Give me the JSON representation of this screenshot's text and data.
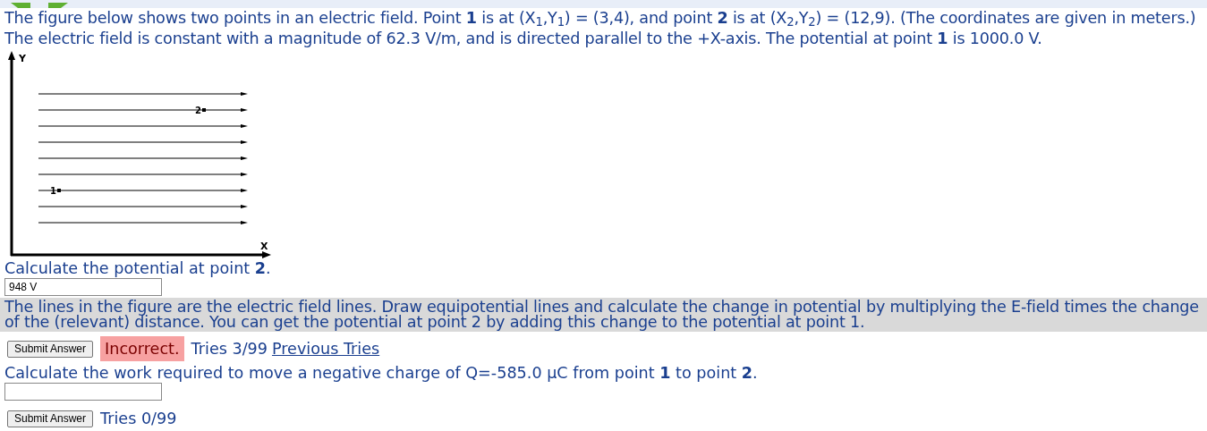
{
  "problem": {
    "text": "The figure below shows two points in an electric field. Point **1** is at (X$_{1}$,Y$_{1}$) = (3,4), and point **2** is at (X$_{2}$,Y$_{2}$) = (12,9). (The coordinates are given in meters.) The electric field is constant with a magnitude of 62.3 V/m, and is directed parallel to the +X-axis. The potential at point **1** is 1000.0 V."
  },
  "figure": {
    "y_label": "Y",
    "x_label": "X",
    "points": [
      {
        "label": "1"
      },
      {
        "label": "2"
      }
    ]
  },
  "questions": [
    {
      "prompt": "Calculate the potential at point **2**.",
      "answer": "948 V",
      "hint": "The lines in the figure are the electric field lines. Draw equipotential lines and calculate the change in potential by multiplying the E-field times the change of the (relevant) distance. You can get the potential at point 2 by adding this change to the potential at point 1.",
      "button": "Submit Answer",
      "feedback": {
        "correct": false,
        "text": "Incorrect."
      },
      "tries": "Tries 3/99",
      "link": "Previous Tries"
    },
    {
      "prompt": "Calculate the work required to move a negative charge of Q=-585.0 μC from point **1** to point **2**.",
      "button": "Submit Answer",
      "tries": "Tries 0/99"
    }
  ]
}
